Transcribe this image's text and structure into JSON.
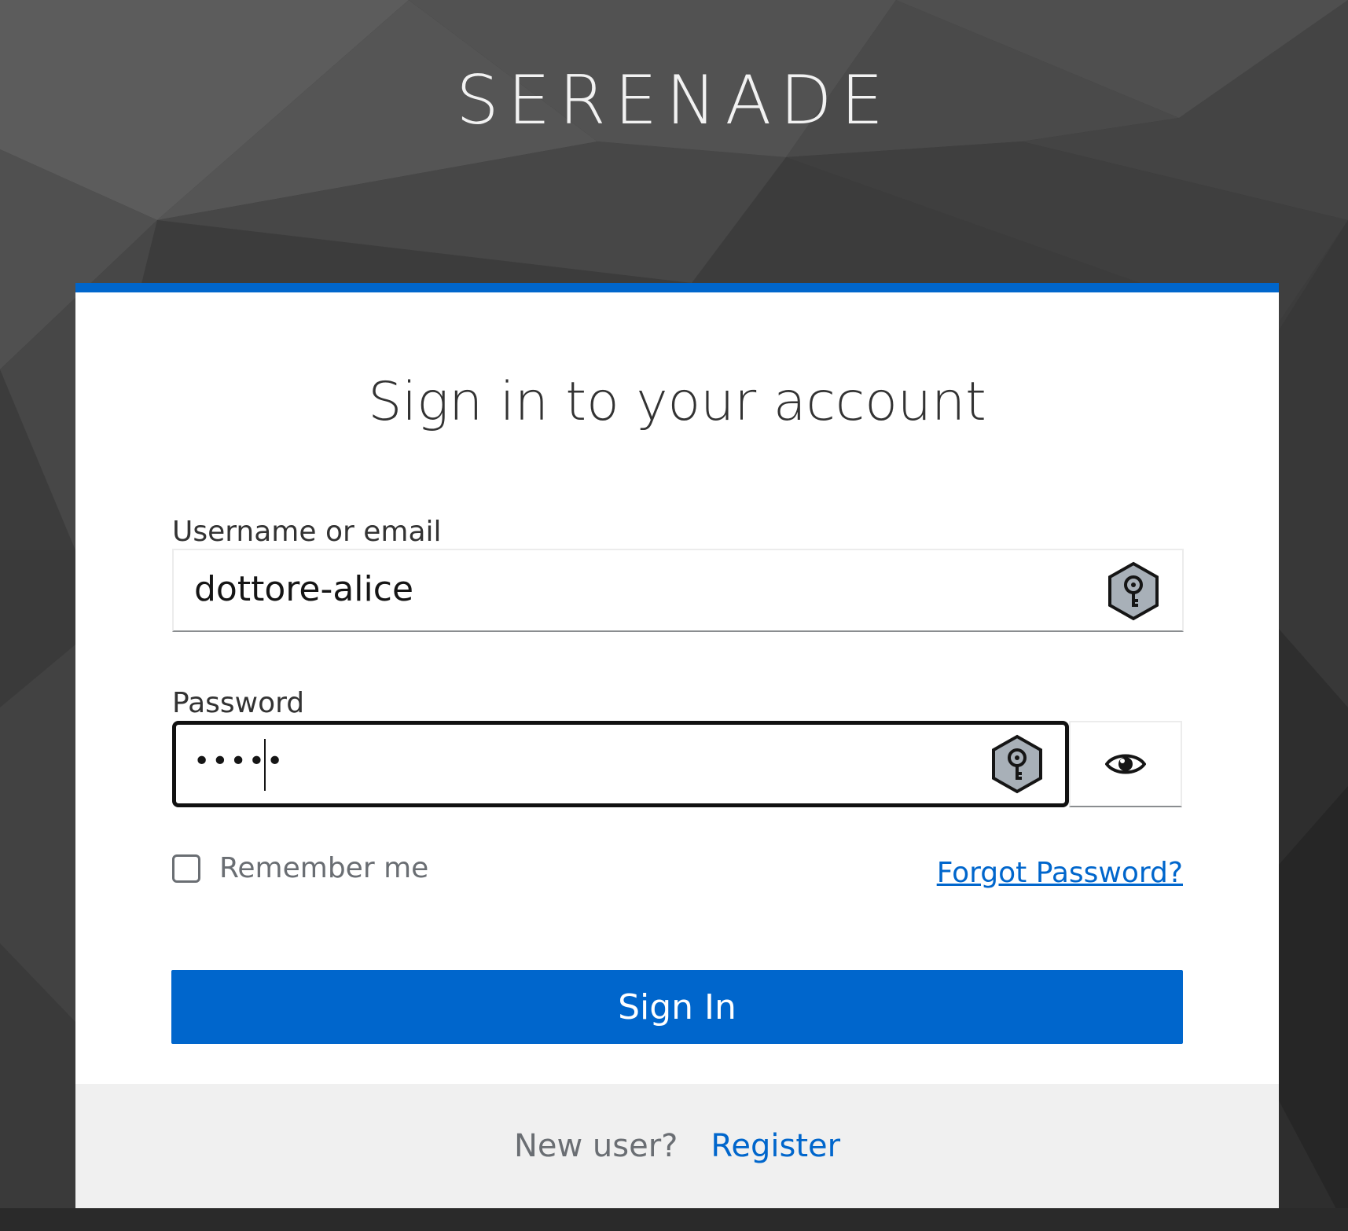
{
  "brand": {
    "name": "SERENADE"
  },
  "form": {
    "title": "Sign in to your account",
    "username": {
      "label": "Username or email",
      "value": "dottore-alice",
      "icon": "password-manager-key-icon"
    },
    "password": {
      "label": "Password",
      "value": "•••••",
      "icon": "password-manager-key-icon",
      "toggle_icon": "eye-icon"
    },
    "remember_me": {
      "label": "Remember me",
      "checked": false
    },
    "forgot_password": "Forgot Password?",
    "submit": "Sign In"
  },
  "footer": {
    "prompt": "New user?",
    "register": "Register"
  },
  "colors": {
    "accent": "#0066cc",
    "background": "#3a3a3a",
    "card": "#ffffff",
    "footer": "#f0f0f0"
  }
}
